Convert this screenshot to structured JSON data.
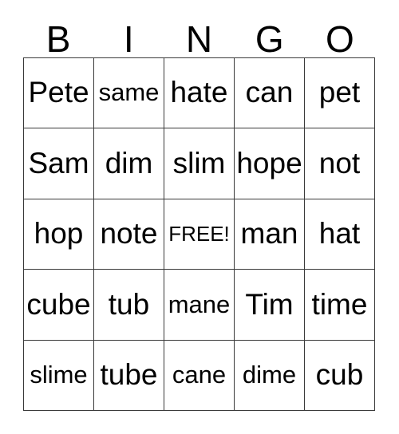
{
  "card": {
    "title": "BINGO",
    "header_letters": [
      "B",
      "I",
      "N",
      "G",
      "O"
    ],
    "grid_size": "5x5",
    "free_space": {
      "label": "FREE!",
      "row": 3,
      "column": 3
    },
    "colors": {
      "background": "#ffffff",
      "text": "#000000",
      "grid_line": "#3a3a3a"
    },
    "columns": [
      {
        "letter": "B",
        "words": [
          "Pete",
          "Sam",
          "hop",
          "cube",
          "slime"
        ]
      },
      {
        "letter": "I",
        "words": [
          "same",
          "dim",
          "note",
          "tub",
          "tube"
        ]
      },
      {
        "letter": "N",
        "words": [
          "hate",
          "slim",
          "FREE!",
          "mane",
          "cane"
        ]
      },
      {
        "letter": "G",
        "words": [
          "can",
          "hope",
          "man",
          "Tim",
          "dime"
        ]
      },
      {
        "letter": "O",
        "words": [
          "pet",
          "not",
          "hat",
          "time",
          "cub"
        ]
      }
    ],
    "rows": [
      [
        "Pete",
        "same",
        "hate",
        "can",
        "pet"
      ],
      [
        "Sam",
        "dim",
        "slim",
        "hope",
        "not"
      ],
      [
        "hop",
        "note",
        "FREE!",
        "man",
        "hat"
      ],
      [
        "cube",
        "tub",
        "mane",
        "Tim",
        "time"
      ],
      [
        "slime",
        "tube",
        "cane",
        "dime",
        "cub"
      ]
    ]
  }
}
